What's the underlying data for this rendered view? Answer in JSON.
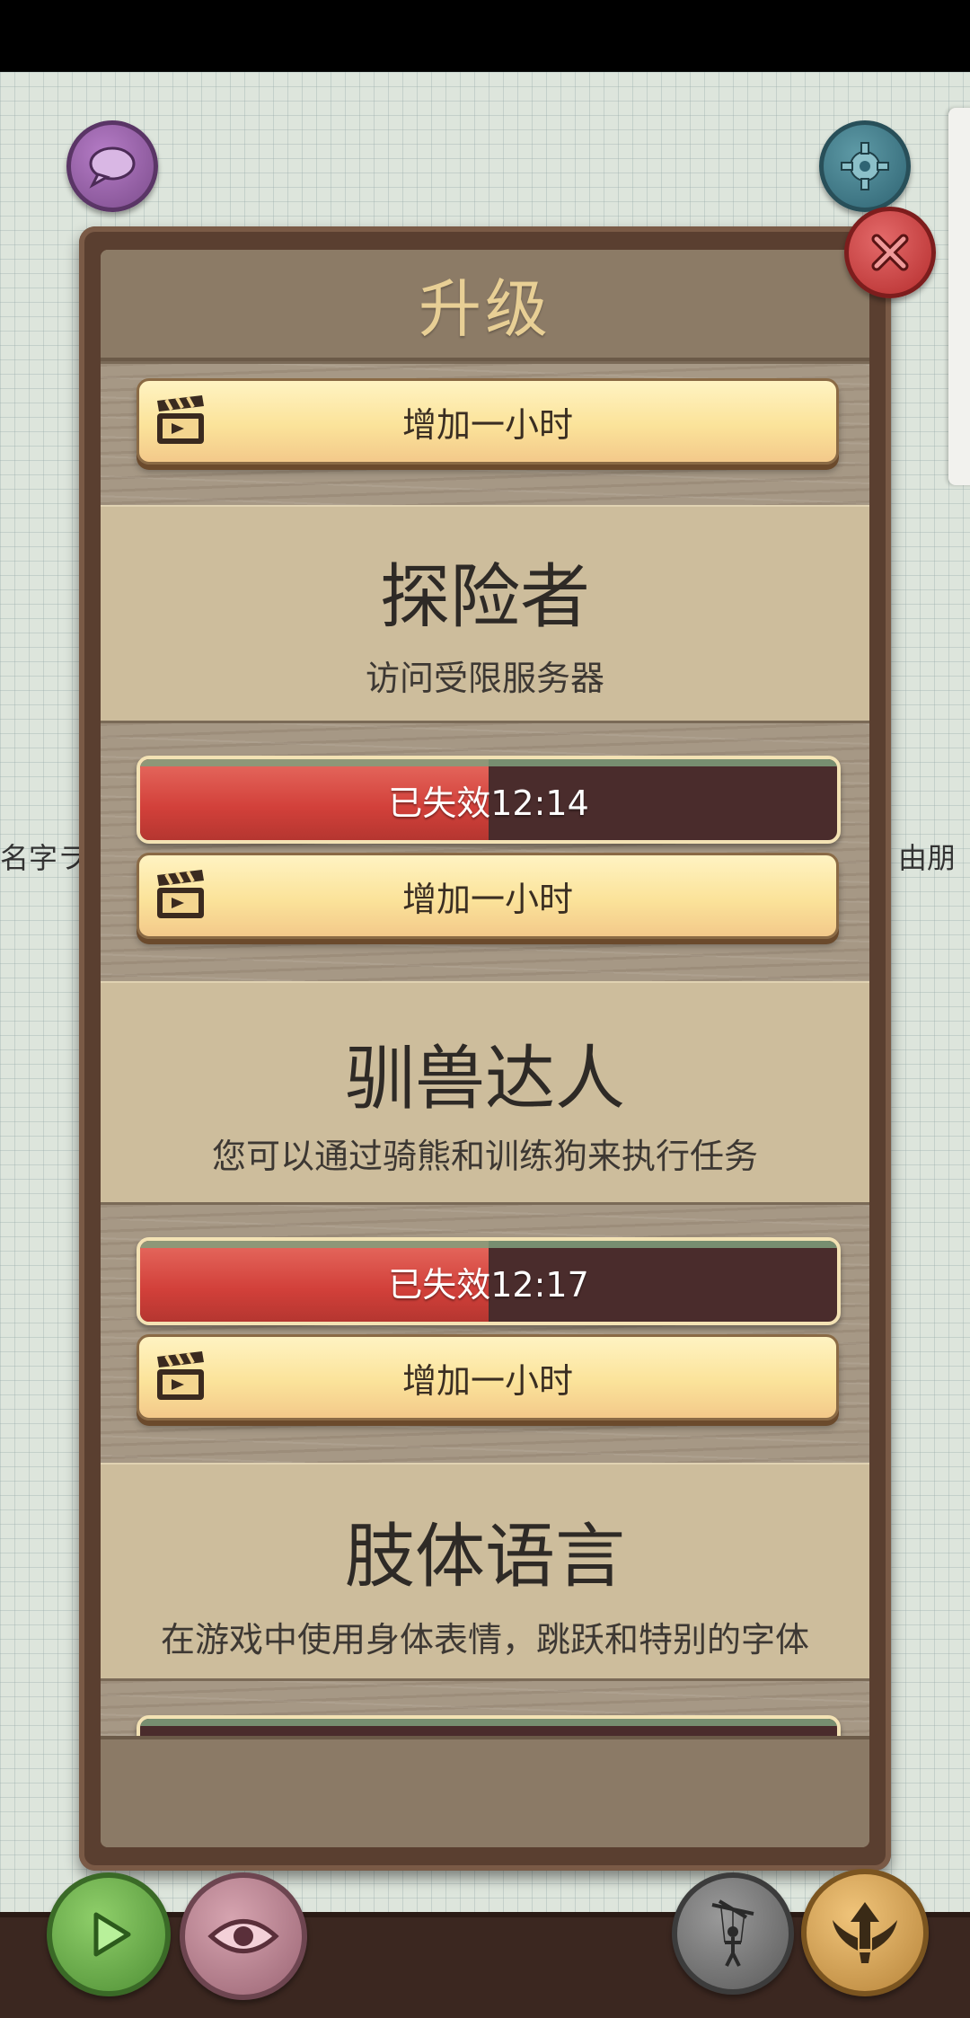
{
  "dialog": {
    "title": "升级"
  },
  "upgrades": [
    {
      "button_label": "增加一小时"
    },
    {
      "title": "探险者",
      "description": "访问受限服务器",
      "status_text": "已失效12:14",
      "status_fill": 0.5,
      "button_label": "增加一小时"
    },
    {
      "title": "驯兽达人",
      "description": "您可以通过骑熊和训练狗来执行任务",
      "status_text": "已失效12:17",
      "status_fill": 0.5,
      "button_label": "增加一小时"
    },
    {
      "title": "肢体语言",
      "description": "在游戏中使用身体表情，跳跃和特别的字体"
    }
  ],
  "background": {
    "left_text": "名字ラ",
    "right_text": "由朋"
  },
  "icons": {
    "chat": "chat-bubble-icon",
    "settings": "gear-icon",
    "close": "close-x-icon",
    "play": "play-icon",
    "eye": "eye-icon",
    "puppet": "puppet-icon",
    "upgrade": "winged-arrow-icon",
    "film": "film-clapper-icon"
  },
  "colors": {
    "progress_fill": "#d2403a",
    "progress_empty": "#4a2c2c",
    "button_yellow": "#fbe39a",
    "title_gold": "#e8cf95"
  }
}
